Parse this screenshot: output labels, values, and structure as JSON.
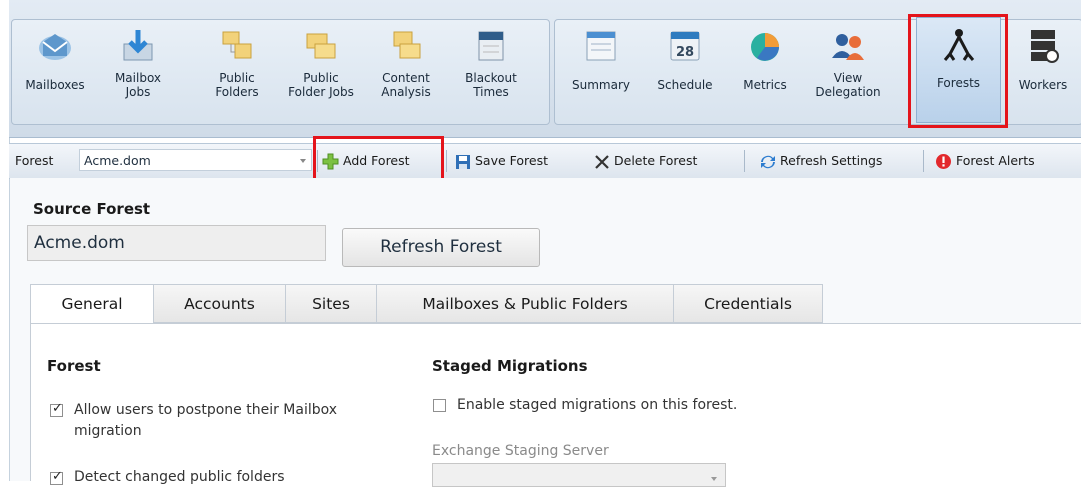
{
  "ribbon": {
    "buttons": [
      {
        "label": "Mailboxes",
        "icon": "mailbox-envelope-icon"
      },
      {
        "label": "Mailbox\nJobs",
        "icon": "mailbox-jobs-icon"
      },
      {
        "label": "Public\nFolders",
        "icon": "public-folders-icon"
      },
      {
        "label": "Public\nFolder Jobs",
        "icon": "public-folder-jobs-icon"
      },
      {
        "label": "Content\nAnalysis",
        "icon": "content-analysis-icon"
      },
      {
        "label": "Blackout\nTimes",
        "icon": "blackout-calendar-icon"
      },
      {
        "label": "Summary",
        "icon": "summary-icon"
      },
      {
        "label": "Schedule",
        "icon": "calendar-icon",
        "day": "28"
      },
      {
        "label": "Metrics",
        "icon": "pie-chart-icon"
      },
      {
        "label": "View\nDelegation",
        "icon": "users-icon"
      },
      {
        "label": "Forests",
        "icon": "forest-tree-icon",
        "selected": true
      },
      {
        "label": "Workers",
        "icon": "workers-server-icon"
      }
    ]
  },
  "toolbar": {
    "forest_label": "Forest",
    "forest_value": "Acme.dom",
    "add_forest": "Add Forest",
    "save_forest": "Save Forest",
    "delete_forest": "Delete Forest",
    "refresh_settings": "Refresh Settings",
    "forest_alerts": "Forest Alerts"
  },
  "source_forest": {
    "title": "Source Forest",
    "value": "Acme.dom",
    "refresh_button": "Refresh Forest"
  },
  "tabs": [
    "General",
    "Accounts",
    "Sites",
    "Mailboxes & Public Folders",
    "Credentials"
  ],
  "general": {
    "forest_title": "Forest",
    "allow_postpone": "Allow users to postpone their Mailbox migration",
    "allow_postpone_checked": true,
    "detect_changed": "Detect changed public folders",
    "detect_changed_checked": true,
    "staged_title": "Staged Migrations",
    "enable_staged": "Enable staged migrations on this forest.",
    "enable_staged_checked": false,
    "staging_server_label": "Exchange Staging Server"
  },
  "colors": {
    "highlight": "#e4141b",
    "ribbon_bg": "#d8e3ee",
    "selected_bg": "#b9d1ea"
  }
}
